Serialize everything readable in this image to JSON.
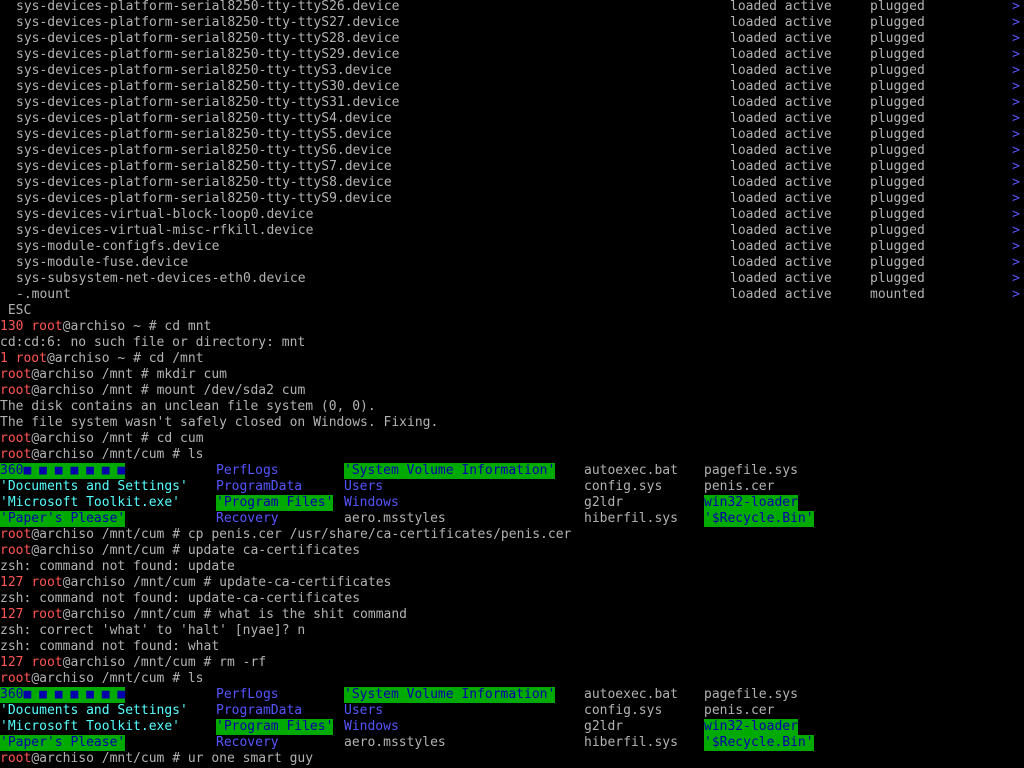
{
  "units": [
    {
      "name": "sys-devices-platform-serial8250-tty-ttyS26.device",
      "load": "loaded",
      "active": "active",
      "sub": "plugged"
    },
    {
      "name": "sys-devices-platform-serial8250-tty-ttyS27.device",
      "load": "loaded",
      "active": "active",
      "sub": "plugged"
    },
    {
      "name": "sys-devices-platform-serial8250-tty-ttyS28.device",
      "load": "loaded",
      "active": "active",
      "sub": "plugged"
    },
    {
      "name": "sys-devices-platform-serial8250-tty-ttyS29.device",
      "load": "loaded",
      "active": "active",
      "sub": "plugged"
    },
    {
      "name": "sys-devices-platform-serial8250-tty-ttyS3.device",
      "load": "loaded",
      "active": "active",
      "sub": "plugged"
    },
    {
      "name": "sys-devices-platform-serial8250-tty-ttyS30.device",
      "load": "loaded",
      "active": "active",
      "sub": "plugged"
    },
    {
      "name": "sys-devices-platform-serial8250-tty-ttyS31.device",
      "load": "loaded",
      "active": "active",
      "sub": "plugged"
    },
    {
      "name": "sys-devices-platform-serial8250-tty-ttyS4.device",
      "load": "loaded",
      "active": "active",
      "sub": "plugged"
    },
    {
      "name": "sys-devices-platform-serial8250-tty-ttyS5.device",
      "load": "loaded",
      "active": "active",
      "sub": "plugged"
    },
    {
      "name": "sys-devices-platform-serial8250-tty-ttyS6.device",
      "load": "loaded",
      "active": "active",
      "sub": "plugged"
    },
    {
      "name": "sys-devices-platform-serial8250-tty-ttyS7.device",
      "load": "loaded",
      "active": "active",
      "sub": "plugged"
    },
    {
      "name": "sys-devices-platform-serial8250-tty-ttyS8.device",
      "load": "loaded",
      "active": "active",
      "sub": "plugged"
    },
    {
      "name": "sys-devices-platform-serial8250-tty-ttyS9.device",
      "load": "loaded",
      "active": "active",
      "sub": "plugged"
    },
    {
      "name": "sys-devices-virtual-block-loop0.device",
      "load": "loaded",
      "active": "active",
      "sub": "plugged"
    },
    {
      "name": "sys-devices-virtual-misc-rfkill.device",
      "load": "loaded",
      "active": "active",
      "sub": "plugged"
    },
    {
      "name": "sys-module-configfs.device",
      "load": "loaded",
      "active": "active",
      "sub": "plugged"
    },
    {
      "name": "sys-module-fuse.device",
      "load": "loaded",
      "active": "active",
      "sub": "plugged"
    },
    {
      "name": "sys-subsystem-net-devices-eth0.device",
      "load": "loaded",
      "active": "active",
      "sub": "plugged"
    },
    {
      "name": "-.mount",
      "load": "loaded",
      "active": "active",
      "sub": "mounted"
    }
  ],
  "arrow_glyph": ">",
  "esc_label": " ESC",
  "prompt": {
    "user": "root",
    "host": "@archiso"
  },
  "session": [
    {
      "kind": "prompt",
      "status": "130",
      "dir": "~",
      "cmd": "cd mnt"
    },
    {
      "kind": "out",
      "text": "cd:cd:6: no such file or directory: mnt"
    },
    {
      "kind": "prompt",
      "status": "1",
      "dir": "~",
      "cmd": "cd /mnt"
    },
    {
      "kind": "prompt",
      "status": "",
      "dir": "/mnt",
      "cmd": "mkdir cum"
    },
    {
      "kind": "prompt",
      "status": "",
      "dir": "/mnt",
      "cmd": "mount /dev/sda2 cum"
    },
    {
      "kind": "out",
      "text": "The disk contains an unclean file system (0, 0)."
    },
    {
      "kind": "out",
      "text": "The file system wasn't safely closed on Windows. Fixing."
    },
    {
      "kind": "prompt",
      "status": "",
      "dir": "/mnt",
      "cmd": "cd cum"
    },
    {
      "kind": "prompt",
      "status": "",
      "dir": "/mnt/cum",
      "cmd": "ls"
    },
    {
      "kind": "ls"
    },
    {
      "kind": "prompt",
      "status": "",
      "dir": "/mnt/cum",
      "cmd": "cp penis.cer /usr/share/ca-certificates/penis.cer"
    },
    {
      "kind": "prompt",
      "status": "",
      "dir": "/mnt/cum",
      "cmd": "update ca-certificates"
    },
    {
      "kind": "out",
      "text": "zsh: command not found: update"
    },
    {
      "kind": "prompt",
      "status": "127",
      "dir": "/mnt/cum",
      "cmd": "update-ca-certificates"
    },
    {
      "kind": "out",
      "text": "zsh: command not found: update-ca-certificates"
    },
    {
      "kind": "prompt",
      "status": "127",
      "dir": "/mnt/cum",
      "cmd": "what is the shit command"
    },
    {
      "kind": "out",
      "text": "zsh: correct 'what' to 'halt' [nyae]? n"
    },
    {
      "kind": "out",
      "text": "zsh: command not found: what"
    },
    {
      "kind": "prompt",
      "status": "127",
      "dir": "/mnt/cum",
      "cmd": "rm -rf"
    },
    {
      "kind": "prompt",
      "status": "",
      "dir": "/mnt/cum",
      "cmd": "ls"
    },
    {
      "kind": "ls"
    },
    {
      "kind": "prompt",
      "status": "",
      "dir": "/mnt/cum",
      "cmd": "ur one smart guy"
    }
  ],
  "ls_rows": [
    [
      {
        "text": "360■ ■ ■ ■ ■ ■ ■",
        "style": "hl"
      },
      {
        "text": "PerfLogs",
        "style": "dir"
      },
      {
        "text": "'System Volume Information'",
        "style": "hl"
      },
      {
        "text": "autoexec.bat",
        "style": "file"
      },
      {
        "text": "pagefile.sys",
        "style": "file"
      }
    ],
    [
      {
        "text": "'Documents and Settings'",
        "style": "lit"
      },
      {
        "text": "ProgramData",
        "style": "dir"
      },
      {
        "text": "Users",
        "style": "dir"
      },
      {
        "text": "config.sys",
        "style": "file"
      },
      {
        "text": "penis.cer",
        "style": "file"
      }
    ],
    [
      {
        "text": "'Microsoft Toolkit.exe'",
        "style": "lit"
      },
      {
        "text": "'Program Files'",
        "style": "hl"
      },
      {
        "text": "Windows",
        "style": "dir"
      },
      {
        "text": "g2ldr",
        "style": "file"
      },
      {
        "text": "win32-loader",
        "style": "hl"
      }
    ],
    [
      {
        "text": "'Paper's Please'",
        "style": "hl"
      },
      {
        "text": "Recovery",
        "style": "dir"
      },
      {
        "text": "aero.msstyles",
        "style": "file"
      },
      {
        "text": "hiberfil.sys",
        "style": "file"
      },
      {
        "text": "'$Recycle.Bin'",
        "style": "hl"
      }
    ]
  ],
  "colors": {
    "background": "#000000",
    "foreground": "#b2b2b2",
    "status_red": "#ff5555",
    "highlight_bg": "#00aa00",
    "highlight_fg": "#0000aa",
    "directory": "#5555ff",
    "quoted_name": "#55ffff",
    "arrow": "#5555ff"
  }
}
